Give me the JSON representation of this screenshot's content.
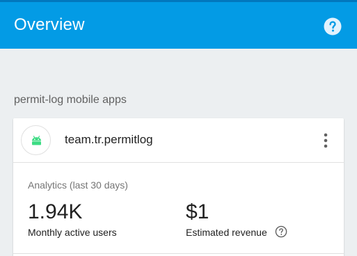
{
  "header": {
    "title": "Overview",
    "help_icon": "help-circle-icon",
    "background_color": "#039be5"
  },
  "section": {
    "label": "permit-log mobile apps"
  },
  "app_card": {
    "platform_icon": "android-icon",
    "app_name": "team.tr.permitlog",
    "menu_icon": "more-vert-icon",
    "analytics": {
      "label": "Analytics (last 30 days)",
      "metrics": [
        {
          "value": "1.94K",
          "label": "Monthly active users"
        },
        {
          "value": "$1",
          "label": "Estimated revenue",
          "help_icon": "help-outline-icon"
        }
      ]
    },
    "accent_color": "#3ddc84"
  }
}
